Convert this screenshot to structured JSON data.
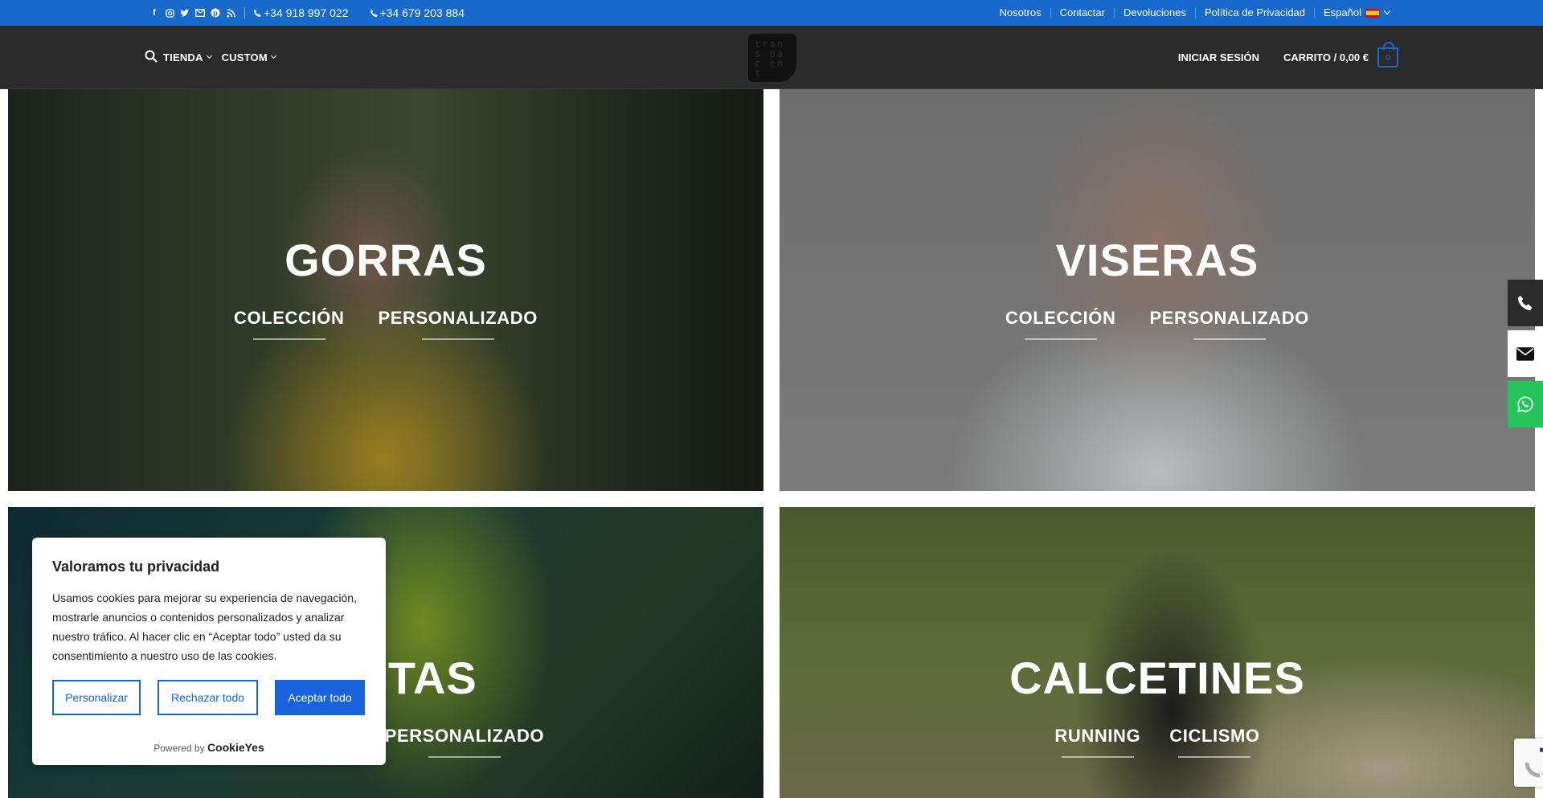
{
  "topbar": {
    "social_icons": [
      "facebook-icon",
      "instagram-icon",
      "twitter-icon",
      "mail-icon",
      "pinterest-icon",
      "rss-icon"
    ],
    "phone1": "+34 918 997 022",
    "phone2": "+34 679 203 884",
    "links": [
      "Nosotros",
      "Contactar",
      "Devoluciones",
      "Política de Privacidad"
    ],
    "language": "Español"
  },
  "header": {
    "menu": [
      "TIENDA",
      "CUSTOM"
    ],
    "logo_text": "trans par ent",
    "login": "INICIAR SESIÓN",
    "cart_label": "CARRITO / 0,00 €",
    "cart_count": "0"
  },
  "tiles": [
    {
      "title": "GORRAS",
      "links": [
        "COLECCIÓN",
        "PERSONALIZADO"
      ]
    },
    {
      "title": "VISERAS",
      "links": [
        "COLECCIÓN",
        "PERSONALIZADO"
      ]
    },
    {
      "title": "SETAS",
      "links": [
        "PERSONALIZADO"
      ]
    },
    {
      "title": "CALCETINES",
      "links": [
        "RUNNING",
        "CICLISMO"
      ]
    }
  ],
  "cookie": {
    "title": "Valoramos tu privacidad",
    "body": "Usamos cookies para mejorar su experiencia de navegación, mostrarle anuncios o contenidos personalizados y analizar nuestro tráfico. Al hacer clic en “Aceptar todo” usted da su consentimiento a nuestro uso de las cookies.",
    "btn_customize": "Personalizar",
    "btn_reject": "Rechazar todo",
    "btn_accept": "Aceptar todo",
    "powered": "Powered by",
    "brand": "CookieYes"
  },
  "colors": {
    "topbar": "#1769cc",
    "header": "#2b2b2b",
    "whatsapp": "#25c45a",
    "cookie_button": "#1863dc"
  }
}
